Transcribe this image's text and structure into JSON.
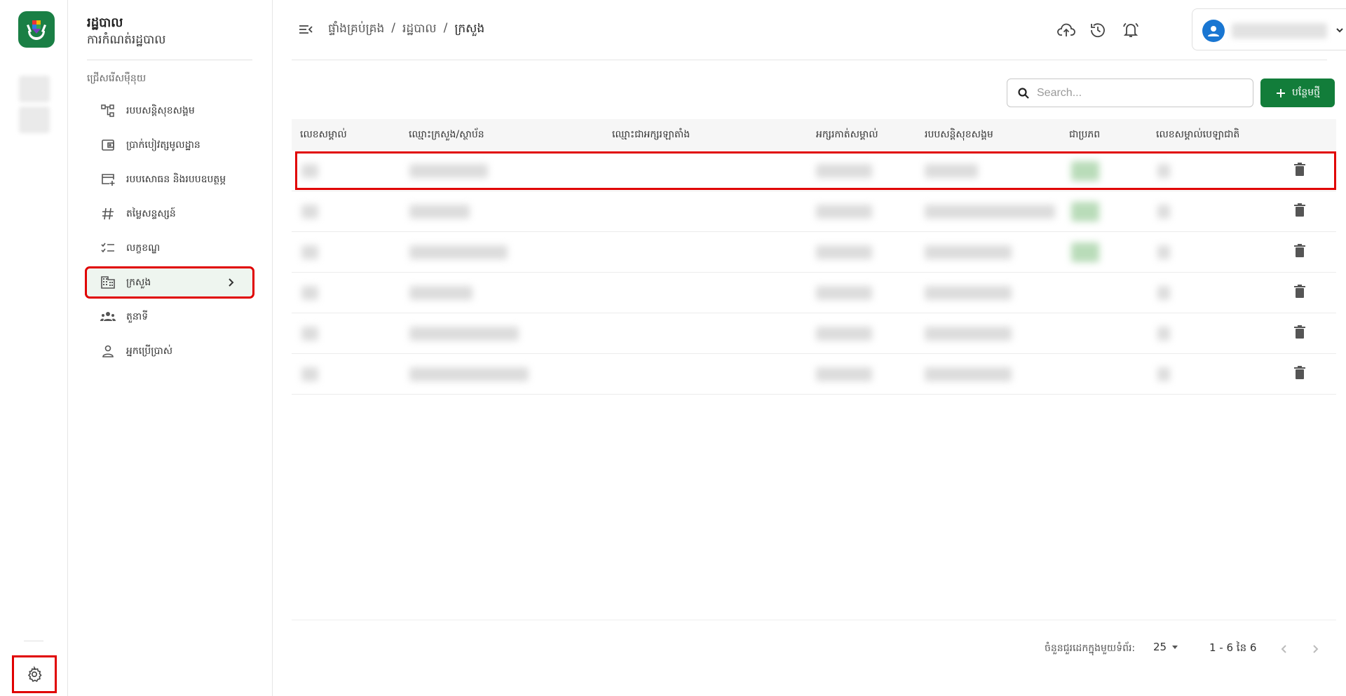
{
  "app": {
    "logo_icon": "helping-hands-logo",
    "brand_color": "#1a7f45",
    "highlight_color": "#e00000"
  },
  "menu": {
    "title": "រដ្ឋបាល",
    "subtitle": "ការកំណត់រដ្ឋបាល",
    "section_label": "ជ្រើសរើសម៉ឺនុយ",
    "items": [
      {
        "label": "របបសន្តិសុខសង្គម",
        "icon": "hierarchy-icon"
      },
      {
        "label": "ប្រាក់បៀវត្សមូលដ្ឋាន",
        "icon": "wallet-icon"
      },
      {
        "label": "របបសោធន និងរបបឧបត្ថម្ភ",
        "icon": "card-add-icon"
      },
      {
        "label": "តម្លៃសន្ទស្សន៍",
        "icon": "hash-icon"
      },
      {
        "label": "លក្ខខណ្ឌ",
        "icon": "checklist-icon"
      },
      {
        "label": "ក្រសួង",
        "icon": "building-icon"
      },
      {
        "label": "តួនាទី",
        "icon": "group-icon"
      },
      {
        "label": "អ្នកប្រើប្រាស់",
        "icon": "person-icon"
      }
    ]
  },
  "header": {
    "breadcrumb": [
      "ផ្ទាំងគ្រប់គ្រង",
      "/",
      "រដ្ឋបាល",
      "/",
      "ក្រសួង"
    ]
  },
  "toolbar": {
    "search_placeholder": "Search...",
    "add_label": "បន្ថែមថ្មី"
  },
  "table": {
    "columns": [
      "លេខសម្គាល់",
      "ឈ្មោះក្រសួង/ស្ថាប័ន",
      "ឈ្មោះជាអក្សរឡាតាំង",
      "អក្សរកាត់សម្គាល់",
      "របបសន្តិសុខសង្គម",
      "ជាប្រភព",
      "លេខសម្គាល់បេឡាជាតិ"
    ]
  },
  "pagination": {
    "rows_per_page_label": "ចំនួនជួរដេកក្នុងមួយទំព័រ:",
    "rows_per_page": "25",
    "range": "1 - 6 នៃ 6"
  }
}
